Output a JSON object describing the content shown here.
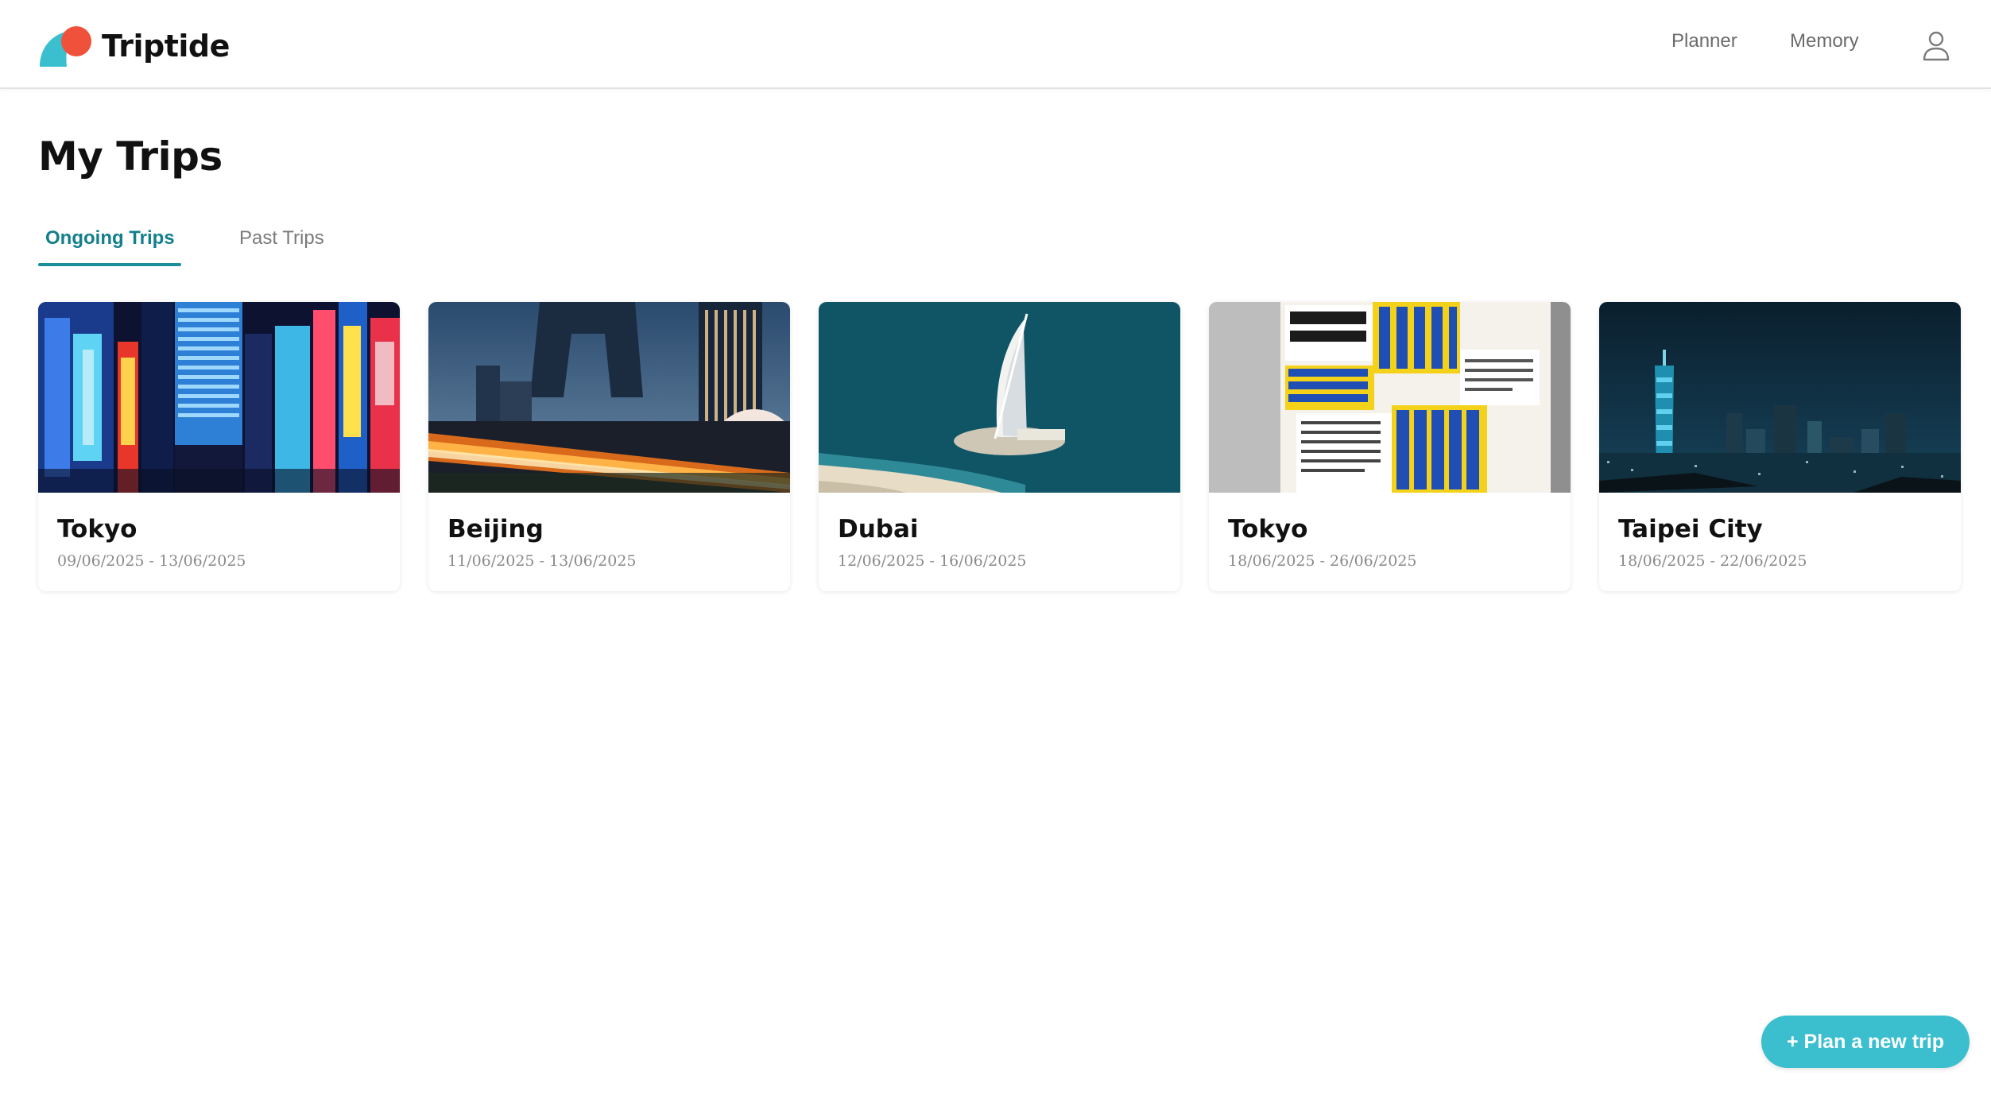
{
  "app": {
    "name": "Triptide",
    "brand_colors": {
      "teal": "#3bbfcf",
      "coral": "#f0513a"
    }
  },
  "header": {
    "nav": [
      {
        "label": "Planner"
      },
      {
        "label": "Memory"
      }
    ],
    "profile_icon": "user-icon"
  },
  "page": {
    "title": "My Trips"
  },
  "tabs": [
    {
      "label": "Ongoing Trips",
      "active": true
    },
    {
      "label": "Past Trips",
      "active": false
    }
  ],
  "trips": [
    {
      "city": "Tokyo",
      "dates": "09/06/2025 - 13/06/2025",
      "photo": "neon-street-photo"
    },
    {
      "city": "Beijing",
      "dates": "11/06/2025 - 13/06/2025",
      "photo": "city-skyline-night-photo"
    },
    {
      "city": "Dubai",
      "dates": "12/06/2025 - 16/06/2025",
      "photo": "sail-hotel-aerial-photo"
    },
    {
      "city": "Tokyo",
      "dates": "18/06/2025 - 26/06/2025",
      "photo": "studio-poster-photo"
    },
    {
      "city": "Taipei City",
      "dates": "18/06/2025 - 22/06/2025",
      "photo": "tower-skyline-night-photo"
    }
  ],
  "actions": {
    "plan_new_trip": "+ Plan a new trip"
  }
}
